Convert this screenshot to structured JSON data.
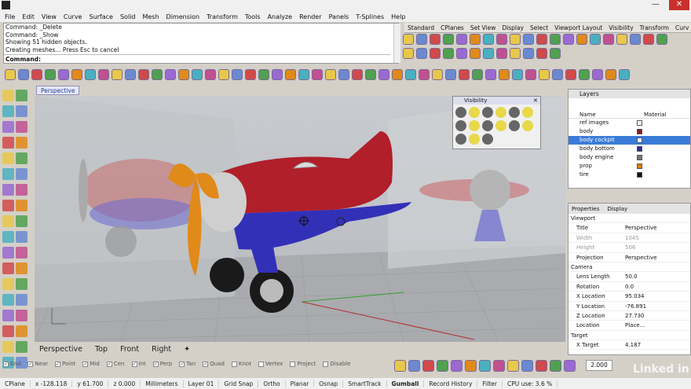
{
  "window": {
    "minimize": "—",
    "close": "✕"
  },
  "menu": [
    "File",
    "Edit",
    "View",
    "Curve",
    "Surface",
    "Solid",
    "Mesh",
    "Dimension",
    "Transform",
    "Tools",
    "Analyze",
    "Render",
    "Panels",
    "T-Splines",
    "Help"
  ],
  "command_history": [
    "Command: _Delete",
    "Command: _Show",
    "Showing 51 hidden objects.",
    "Creating meshes... Press Esc to cancel"
  ],
  "command_prompt": "Command:",
  "toolbar_tabs": [
    "Standard",
    "CPlanes",
    "Set View",
    "Display",
    "Select",
    "Viewport Layout",
    "Visibility",
    "Transform",
    "Curv"
  ],
  "viewport": {
    "title": "Perspective",
    "tabs": [
      "Perspective",
      "Top",
      "Front",
      "Right"
    ],
    "add_tab": "✦"
  },
  "visibility_panel": {
    "title": "Visibility"
  },
  "layers": {
    "title": "Layers",
    "col_name": "Name",
    "col_material": "Material",
    "rows": [
      {
        "name": "ref images",
        "color": "#ffffff"
      },
      {
        "name": "body",
        "color": "#8b1a1a"
      },
      {
        "name": "body cockpit",
        "color": "#ffffff",
        "selected": true
      },
      {
        "name": "body bottom",
        "color": "#2a2aa0"
      },
      {
        "name": "body engine",
        "color": "#777777"
      },
      {
        "name": "prop",
        "color": "#e07a10"
      },
      {
        "name": "tire",
        "color": "#111111"
      }
    ]
  },
  "properties": {
    "tab_properties": "Properties",
    "tab_display": "Display",
    "rows": [
      {
        "k": "Viewport",
        "v": "",
        "section": true
      },
      {
        "k": "Title",
        "v": "Perspective"
      },
      {
        "k": "Width",
        "v": "1045",
        "dis": true
      },
      {
        "k": "Height",
        "v": "506",
        "dis": true
      },
      {
        "k": "Projection",
        "v": "Perspective"
      },
      {
        "k": "Camera",
        "v": "",
        "section": true
      },
      {
        "k": "Lens Length",
        "v": "50.0"
      },
      {
        "k": "Rotation",
        "v": "0.0"
      },
      {
        "k": "X Location",
        "v": "95.034"
      },
      {
        "k": "Y Location",
        "v": "-76.891"
      },
      {
        "k": "Z Location",
        "v": "27.730"
      },
      {
        "k": "Location",
        "v": "Place..."
      },
      {
        "k": "Target",
        "v": "",
        "section": true
      },
      {
        "k": "X Target",
        "v": "4.187"
      }
    ]
  },
  "osnaps": [
    {
      "label": "End",
      "on": true
    },
    {
      "label": "Near",
      "on": true
    },
    {
      "label": "Point",
      "on": true
    },
    {
      "label": "Mid",
      "on": true
    },
    {
      "label": "Cen",
      "on": true
    },
    {
      "label": "Int",
      "on": true
    },
    {
      "label": "Perp",
      "on": true
    },
    {
      "label": "Tan",
      "on": true
    },
    {
      "label": "Quad",
      "on": true
    },
    {
      "label": "Knot",
      "on": false
    },
    {
      "label": "Vertex",
      "on": false
    },
    {
      "label": "Project",
      "on": false
    },
    {
      "label": "Disable",
      "on": false
    }
  ],
  "zoom_value": "2.000",
  "status": {
    "cplane": "CPlane",
    "x": "x -128.118",
    "y": "y 61.700",
    "z": "z 0.000",
    "units": "Millimeters",
    "layer": "Layer 01",
    "grid_snap": "Grid Snap",
    "ortho": "Ortho",
    "planar": "Planar",
    "osnap": "Osnap",
    "smarttrack": "SmartTrack",
    "gumball": "Gumball",
    "record_history": "Record History",
    "filter": "Filter",
    "cpu": "CPU use: 3.6 %"
  },
  "watermark": "Linked in"
}
